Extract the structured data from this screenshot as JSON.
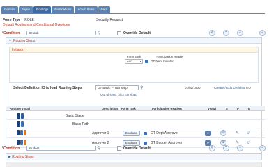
{
  "tabs": [
    "General",
    "Pages",
    "Routings",
    "Notifications",
    "Action Items",
    "Data"
  ],
  "meta": {
    "form_type_label": "Form Type",
    "form_type_value": "ROLE",
    "security_text": "Security Request",
    "page_title": "Default Routings and Conditional Overrides"
  },
  "condition1": {
    "label": "*Condition",
    "value": "Default",
    "override_label": "Override Default",
    "override_checked": false,
    "panel_title": "Routing Steps",
    "initiator_title": "Initiator",
    "form_task_label": "Form Task",
    "form_task_value": "Add",
    "participation_reader_label": "Participation Reader",
    "participation_reader_value": "GT Dept Initiator",
    "select_def_label": "Select Definition ID to load Routing Steps",
    "select_def_value": "GT Basic -- Two Step",
    "date_value": "01/02/1900",
    "create_edit_link": "Create / Edit Definition ID",
    "out_of_sync": "Out of sync, click to reload"
  },
  "grid": {
    "headers": [
      "Routing Visual",
      "Description",
      "Form Task",
      "Participation Readers",
      "Visual",
      "S",
      "P",
      "R"
    ],
    "rows": [
      {
        "desc": "Basic Stage",
        "form_task": "",
        "reader": ""
      },
      {
        "desc": "Basic Path",
        "form_task": "",
        "reader": ""
      },
      {
        "desc": "Approver 1",
        "form_task": "Evaluate",
        "reader": "GT Dept Approver"
      },
      {
        "desc": "Approver 2",
        "form_task": "Evaluate",
        "reader": "GT Budget Approver"
      }
    ]
  },
  "condition2": {
    "label": "*Condition",
    "value": "Student",
    "override_label": "Override Default",
    "panel_title": "Routing Steps"
  },
  "colors": {
    "tab_blue": "#5b84b8",
    "required_red": "#b23b2a",
    "link_blue": "#2f5b93"
  }
}
